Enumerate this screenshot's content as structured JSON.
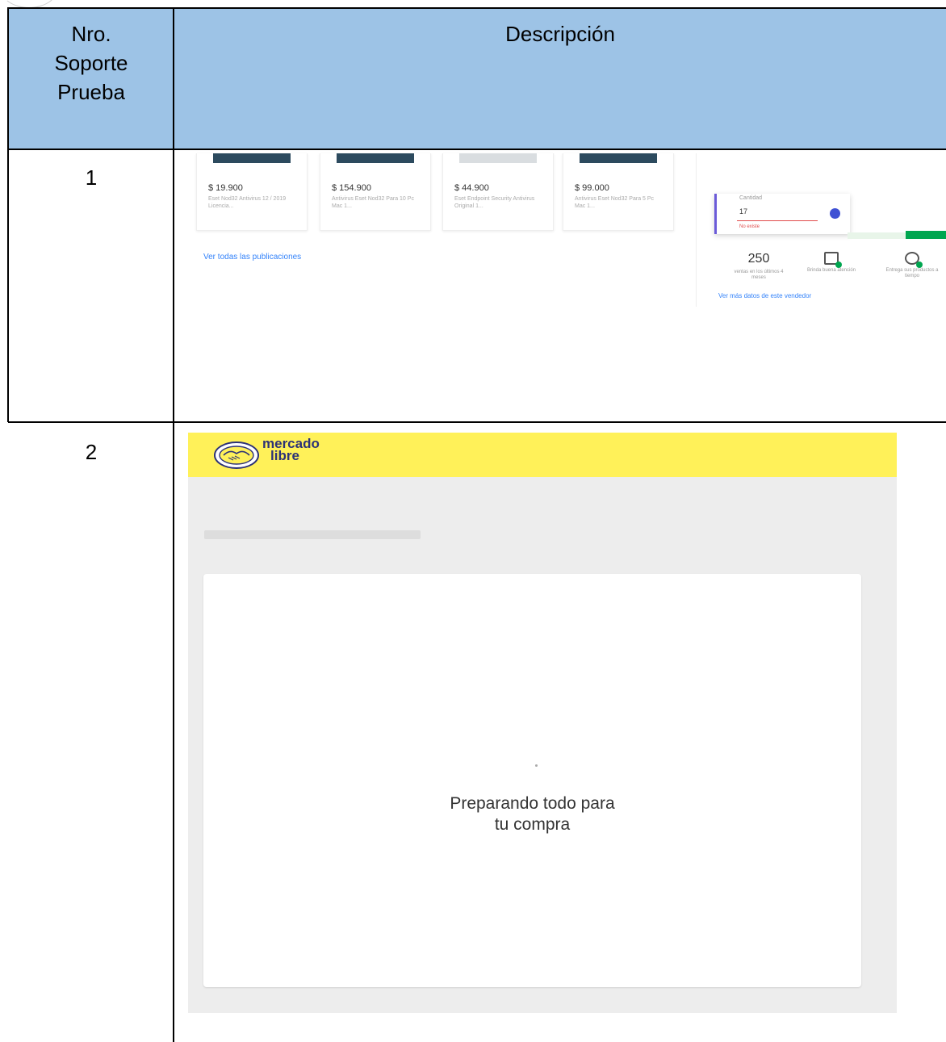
{
  "table": {
    "header": {
      "col1_lines": [
        "Nro.",
        "Soporte",
        "Prueba"
      ],
      "col2": "Descripción"
    },
    "rows": [
      {
        "number": "1"
      },
      {
        "number": "2"
      }
    ]
  },
  "row1_screenshot": {
    "products": [
      {
        "price": "$ 19.900",
        "name": "Eset Nod32 Antivirus 12 / 2019 Licencia..."
      },
      {
        "price": "$ 154.900",
        "name": "Antivirus Eset Nod32 Para 10 Pc Mac 1..."
      },
      {
        "price": "$ 44.900",
        "name": "Eset Endpoint Security Antivirus Original 1..."
      },
      {
        "price": "$ 99.000",
        "name": "Antivirus Eset Nod32 Para 5 Pc Mac 1..."
      }
    ],
    "see_all_link": "Ver todas las publicaciones",
    "quantity": {
      "label": "Cantidad",
      "value": "17",
      "error": "No existe"
    },
    "stats": [
      {
        "value": "250",
        "description": "ventas en los últimos 4 meses"
      },
      {
        "value": "",
        "description": "Brinda buena atención"
      },
      {
        "value": "",
        "description": "Entrega sus productos a tiempo"
      }
    ],
    "seller_link": "Ver más datos de este vendedor"
  },
  "row2_screenshot": {
    "brand_line1": "mercado",
    "brand_line2": "libre",
    "brand_color": "#fff159",
    "message_line1": "Preparando todo para",
    "message_line2": "tu compra"
  }
}
